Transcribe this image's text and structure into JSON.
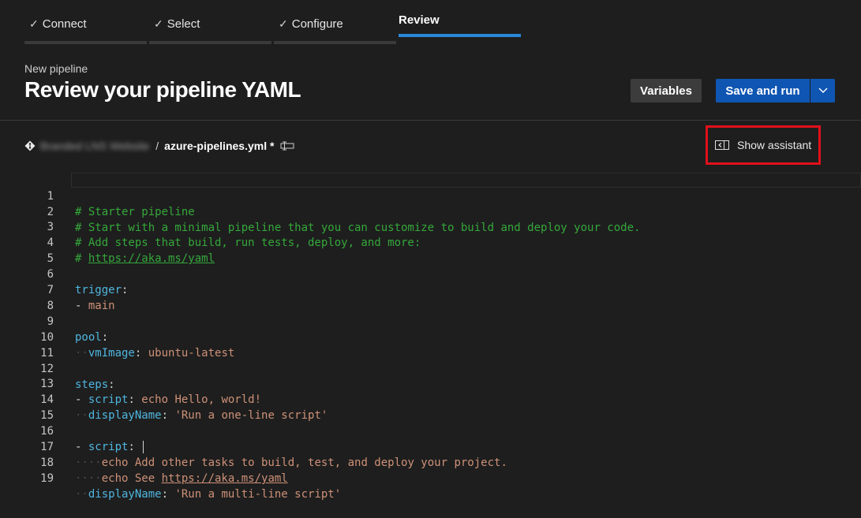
{
  "wizard": {
    "steps": [
      {
        "label": "Connect",
        "done": true
      },
      {
        "label": "Select",
        "done": true
      },
      {
        "label": "Configure",
        "done": true
      },
      {
        "label": "Review",
        "done": false,
        "active": true
      }
    ]
  },
  "header": {
    "subtitle": "New pipeline",
    "title": "Review your pipeline YAML"
  },
  "toolbar": {
    "variables_label": "Variables",
    "save_label": "Save and run"
  },
  "path": {
    "repo": "Branded LNS Website",
    "separator": "/",
    "file": "azure-pipelines.yml *"
  },
  "assistant": {
    "label": "Show assistant"
  },
  "editor": {
    "line_numbers": [
      "1",
      "2",
      "3",
      "4",
      "5",
      "6",
      "7",
      "8",
      "9",
      "10",
      "11",
      "12",
      "13",
      "14",
      "15",
      "16",
      "17",
      "18",
      "19"
    ],
    "lines": {
      "l1": "# Starter pipeline",
      "l2": "# Start with a minimal pipeline that you can customize to build and deploy your code.",
      "l3": "# Add steps that build, run tests, deploy, and more:",
      "l4_prefix": "# ",
      "l4_link": "https://aka.ms/yaml",
      "l6_key": "trigger",
      "l7_dash": "- ",
      "l7_val": "main",
      "l9_key": "pool",
      "l10_key": "vmImage",
      "l10_val": "ubuntu-latest",
      "l12_key": "steps",
      "l13_key": "script",
      "l13_val": "echo Hello, world!",
      "l14_key": "displayName",
      "l14_val": "'Run a one-line script'",
      "l16_key": "script",
      "l17_val": "echo Add other tasks to build, test, and deploy your project.",
      "l18_val": "echo See ",
      "l18_link": "https://aka.ms/yaml",
      "l19_key": "displayName",
      "l19_val": "'Run a multi-line script'"
    }
  },
  "colors": {
    "accent": "#2b88d8",
    "primary_button": "#0f56b3",
    "highlight_box": "#e0101b",
    "comment": "#35a83b",
    "yaml_key": "#4fb6e0",
    "yaml_string": "#ce9178"
  }
}
